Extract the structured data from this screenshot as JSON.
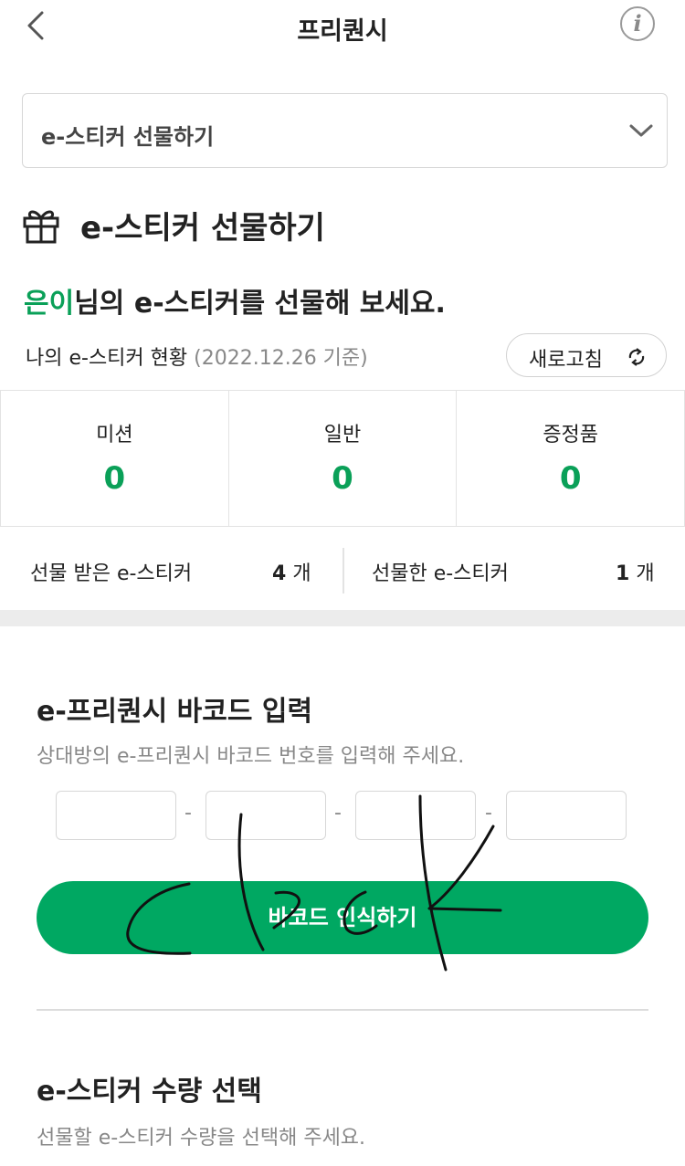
{
  "header": {
    "title": "프리퀀시",
    "back_icon": "chevron-left-icon",
    "info_icon": "info-icon",
    "info_glyph": "i"
  },
  "dropdown": {
    "selected": "e-스티커 선물하기",
    "icon": "chevron-down-icon"
  },
  "section": {
    "icon": "gift-icon",
    "title": "e-스티커 선물하기"
  },
  "greeting": {
    "name": "은이",
    "text": "님의 e-스티커를 선물해 보세요."
  },
  "status": {
    "label": "나의 e-스티커 현황",
    "date": "(2022.12.26 기준)",
    "refresh_label": "새로고침",
    "refresh_icon": "refresh-icon"
  },
  "sticker_counts": [
    {
      "label": "미션",
      "value": "0"
    },
    {
      "label": "일반",
      "value": "0"
    },
    {
      "label": "증정품",
      "value": "0"
    }
  ],
  "gift_summary": {
    "received_label": "선물 받은 e-스티커",
    "received_count": "4",
    "sent_label": "선물한 e-스티커",
    "sent_count": "1",
    "unit": "개"
  },
  "barcode": {
    "title": "e-프리퀀시 바코드 입력",
    "subtitle": "상대방의 e-프리퀀시 바코드 번호를 입력해 주세요.",
    "fields": [
      "",
      "",
      "",
      ""
    ],
    "separator": "-",
    "scan_button": "바코드 인식하기"
  },
  "quantity": {
    "title": "e-스티커 수량 선택",
    "subtitle": "선물할 e-스티커 수량을 선택해 주세요."
  },
  "annotation": {
    "color": "#111111",
    "text": "Click"
  },
  "colors": {
    "accent": "#0aa058",
    "button": "#00a862"
  }
}
